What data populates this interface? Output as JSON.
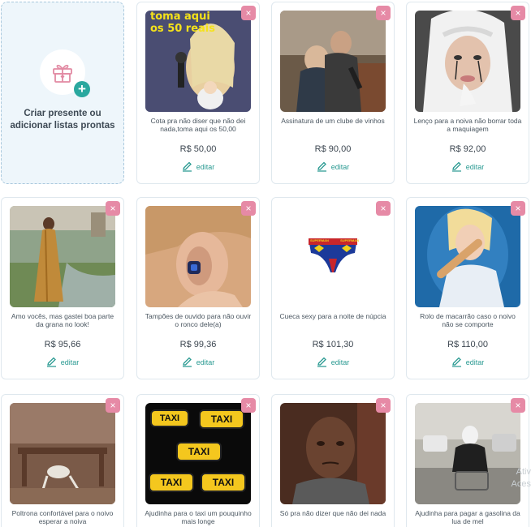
{
  "create_card": {
    "label": "Criar presente ou adicionar listas prontas",
    "icon": "gift-icon",
    "accent": "#2aa89f"
  },
  "close_symbol": "×",
  "edit_label": "editar",
  "products": [
    {
      "description": "Cota pra não diser que não dei nada,toma aqui os 50,00",
      "price": "R$ 50,00",
      "image_text": [
        "toma aqui",
        "os 50 reais"
      ]
    },
    {
      "description": "Assinatura de um clube de vinhos",
      "price": "R$ 90,00"
    },
    {
      "description": "Lenço para a noiva não borrar toda a maquiagem",
      "price": "R$ 92,00"
    },
    {
      "description": "Amo vocês, mas gastei boa parte da grana no look!",
      "price": "R$ 95,66"
    },
    {
      "description": "Tampões de ouvido para não ouvir o ronco dele(a)",
      "price": "R$ 99,36"
    },
    {
      "description": "Cueca sexy para a noite de núpcia",
      "price": "R$ 101,30",
      "image_text": [
        "SUPERMAN",
        "SUPERMAN"
      ]
    },
    {
      "description": "Rolo de macarrão caso o noivo não se comporte",
      "price": "R$ 110,00"
    },
    {
      "description": "Poltrona confortável para o noivo esperar a noiva",
      "price": ""
    },
    {
      "description": "Ajudinha para o taxi um pouquinho mais longe",
      "price": "",
      "image_text": [
        "TAXI",
        "TAXI",
        "TAXI",
        "TAXI",
        "TAXI"
      ]
    },
    {
      "description": "Só pra não dizer que não dei nada",
      "price": ""
    },
    {
      "description": "Ajudinha para pagar a gasolina da lua de mel",
      "price": ""
    }
  ],
  "overlay": {
    "line1": "Ativ",
    "line2": "Aces"
  },
  "colors": {
    "close": "#e68aa6",
    "edit": "#2a9a92",
    "create_bg": "#eef6fb"
  }
}
